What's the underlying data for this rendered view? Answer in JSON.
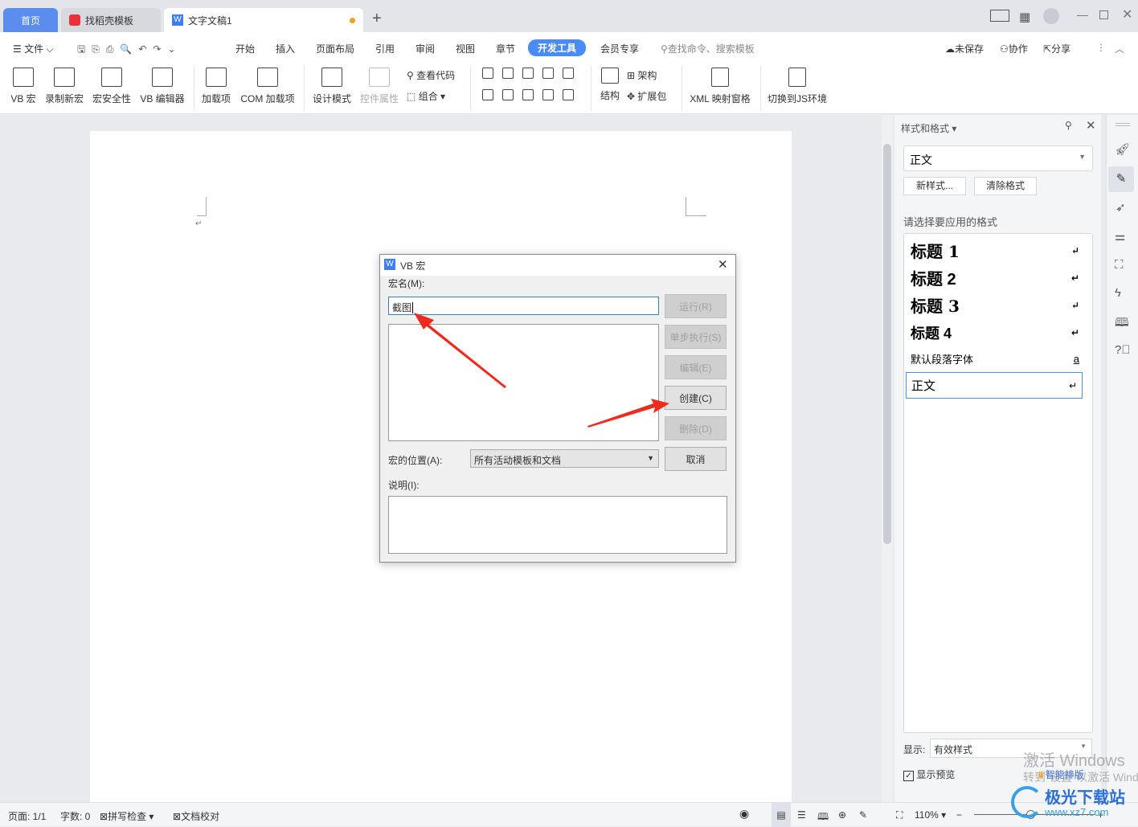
{
  "tabs": [
    {
      "label": "首页",
      "active": false,
      "color": "#5b8def"
    },
    {
      "label": "找稻壳模板"
    },
    {
      "label": "文字文稿1",
      "unsaved": true
    }
  ],
  "window": {
    "new_tab": "+"
  },
  "menu": {
    "file": "文件",
    "items": [
      "开始",
      "插入",
      "页面布局",
      "引用",
      "审阅",
      "视图",
      "章节",
      "开发工具",
      "会员专享"
    ],
    "active": "开发工具",
    "search_placeholder": "查找命令、搜索模板",
    "unsaved": "未保存",
    "collab": "协作",
    "share": "分享",
    "accent": "#4a8cf7"
  },
  "ribbon": {
    "vb_macro": "VB 宏",
    "record": "录制新宏",
    "security": "宏安全性",
    "vb_editor": "VB 编辑器",
    "addins": "加载项",
    "com_addins": "COM 加载项",
    "design_mode": "设计模式",
    "control_props": "控件属性",
    "view_code": "查看代码",
    "group": "组合",
    "structure": "结构",
    "schema": "架构",
    "expansion": "扩展包",
    "xml_pane": "XML 映射窗格",
    "js_env": "切换到JS环境"
  },
  "dialog": {
    "title": "VB 宏",
    "macro_name_label": "宏名(M):",
    "macro_name_value": "截图",
    "run": "运行(R)",
    "step": "单步执行(S)",
    "edit": "编辑(E)",
    "create": "创建(C)",
    "delete": "删除(D)",
    "cancel": "取消",
    "location_label": "宏的位置(A):",
    "location_value": "所有活动模板和文档",
    "description_label": "说明(I):"
  },
  "panel": {
    "title": "样式和格式",
    "current_style": "正文",
    "new_style": "新样式...",
    "clear_format": "清除格式",
    "apply_label": "请选择要应用的格式",
    "styles": [
      {
        "label": "标题  1",
        "mark": "↵"
      },
      {
        "label": "标题  2",
        "mark": "↵"
      },
      {
        "label": "标题  3",
        "mark": "↵"
      },
      {
        "label": "标题  4",
        "mark": "↵"
      },
      {
        "label": "默认段落字体",
        "mark": "a"
      },
      {
        "label": "正文",
        "mark": "↵",
        "selected": true
      }
    ],
    "show_label": "显示:",
    "show_value": "有效样式",
    "preview_label": "显示预览",
    "preview_checked": true
  },
  "status": {
    "page": "页面: 1/1",
    "words": "字数: 0",
    "spell": "拼写检查",
    "proof": "文档校对",
    "zoom": "110%",
    "zoom_percent": 110
  },
  "overlay": {
    "activate_line1": "激活 Windows",
    "activate_line2": "转到\"设置\"以激活 Windows。",
    "smart_layout": "智能排版",
    "watermark": "极光下载站",
    "watermark_url": "www.xz7.com"
  }
}
